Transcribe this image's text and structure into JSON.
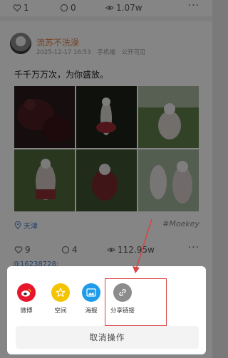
{
  "top_stats": {
    "likes": "1",
    "comments": "0",
    "views": "1.07w"
  },
  "post": {
    "username": "流苏不洗澡",
    "timestamp": "2025-12-17 16:53",
    "device": "手机端",
    "visibility": "公开可见",
    "text": "千千万万次，为你盛放。",
    "location": "天津",
    "hashtag": "#Moekey"
  },
  "bottom_stats": {
    "likes": "9",
    "comments": "4",
    "views": "112.95w"
  },
  "reply_preview": "@16238728:",
  "share_sheet": {
    "items": [
      {
        "label": "微博",
        "icon": "weibo-icon",
        "color": "#e6162d"
      },
      {
        "label": "空间",
        "icon": "qzone-star-icon",
        "color": "#f5c400"
      },
      {
        "label": "海报",
        "icon": "poster-image-icon",
        "color": "#1e9be9"
      },
      {
        "label": "分享链接",
        "icon": "link-icon",
        "color": "#8c8c8c"
      }
    ],
    "cancel_label": "取消操作"
  },
  "annotation": {
    "highlight_color": "#d64545"
  }
}
